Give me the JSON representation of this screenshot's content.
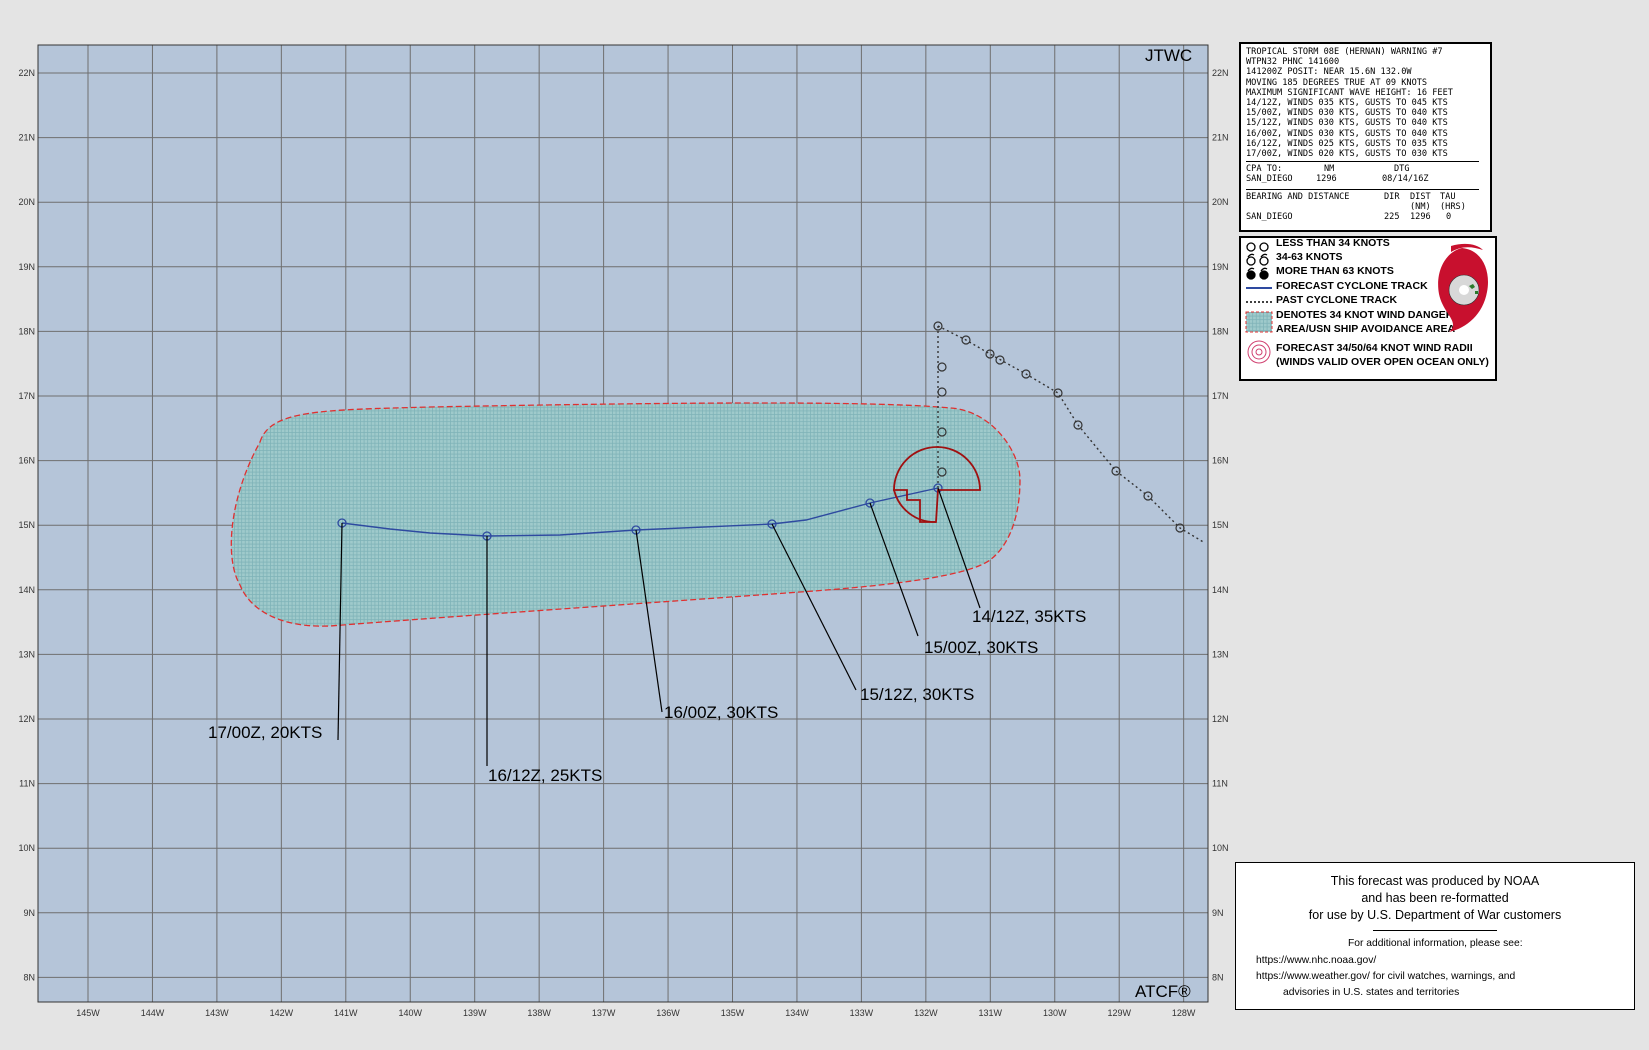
{
  "map": {
    "brand_top": "JTWC",
    "brand_bottom": "ATCF®",
    "lat_labels": [
      "22N",
      "21N",
      "20N",
      "19N",
      "18N",
      "17N",
      "16N",
      "15N",
      "14N",
      "13N",
      "12N",
      "11N",
      "10N",
      "9N",
      "8N"
    ],
    "lon_labels": [
      "145W",
      "144W",
      "143W",
      "142W",
      "141W",
      "140W",
      "139W",
      "138W",
      "137W",
      "136W",
      "135W",
      "134W",
      "133W",
      "132W",
      "131W",
      "130W",
      "129W",
      "128W"
    ],
    "forecast_labels": [
      "14/12Z,  35KTS",
      "15/00Z,  30KTS",
      "15/12Z,  30KTS",
      "16/00Z,  30KTS",
      "16/12Z,  25KTS",
      "17/00Z,  20KTS"
    ],
    "colors": {
      "ocean": "#b5c5d9",
      "grid": "#6f6f6f",
      "danger_fill": "#98c6c8",
      "danger_edge": "#e03030",
      "forecast_track": "#2e4aa0",
      "wind_radii": "#a01010"
    }
  },
  "warning": {
    "lines": [
      "TROPICAL STORM 08E (HERNAN) WARNING #7",
      "WTPN32 PHNC 141600",
      "141200Z POSIT: NEAR 15.6N 132.0W",
      "MOVING 185 DEGREES TRUE AT 09 KNOTS",
      "MAXIMUM SIGNIFICANT WAVE HEIGHT: 16 FEET",
      "14/12Z, WINDS 035 KTS, GUSTS TO 045 KTS",
      "15/00Z, WINDS 030 KTS, GUSTS TO 040 KTS",
      "15/12Z, WINDS 030 KTS, GUSTS TO 040 KTS",
      "16/00Z, WINDS 030 KTS, GUSTS TO 040 KTS",
      "16/12Z, WINDS 025 KTS, GUSTS TO 035 KTS",
      "17/00Z, WINDS 020 KTS, GUSTS TO 030 KTS"
    ],
    "cpa_header": {
      "col1": "CPA TO:",
      "col2": "NM",
      "col3": "DTG"
    },
    "cpa_row": {
      "place": "SAN_DIEGO",
      "nm": "1296",
      "dtg": "08/14/16Z"
    },
    "bearing_header": {
      "col1": "BEARING AND DISTANCE",
      "col2": "DIR",
      "col3": "DIST",
      "col4": "TAU"
    },
    "bearing_units": {
      "col3": "(NM)",
      "col4": "(HRS)"
    },
    "bearing_row": {
      "place": "SAN_DIEGO",
      "dir": "225",
      "dist": "1296",
      "tau": "0"
    }
  },
  "legend": {
    "items": [
      "LESS THAN 34 KNOTS",
      "34-63 KNOTS",
      "MORE THAN 63 KNOTS",
      "FORECAST CYCLONE TRACK",
      "PAST CYCLONE TRACK",
      "DENOTES 34 KNOT WIND DANGER",
      "AREA/USN SHIP AVOIDANCE AREA",
      "FORECAST 34/50/64 KNOT WIND RADII",
      "(WINDS VALID OVER OPEN OCEAN ONLY)"
    ]
  },
  "noaa": {
    "lines": [
      "This forecast was produced by NOAA",
      "and has been re-formatted",
      "for use by U.S. Department of War customers"
    ],
    "info_lines": [
      "For additional information, please see:",
      "https://www.nhc.noaa.gov/",
      "https://www.weather.gov/ for civil watches, warnings, and",
      "advisories in U.S. states and territories"
    ]
  }
}
